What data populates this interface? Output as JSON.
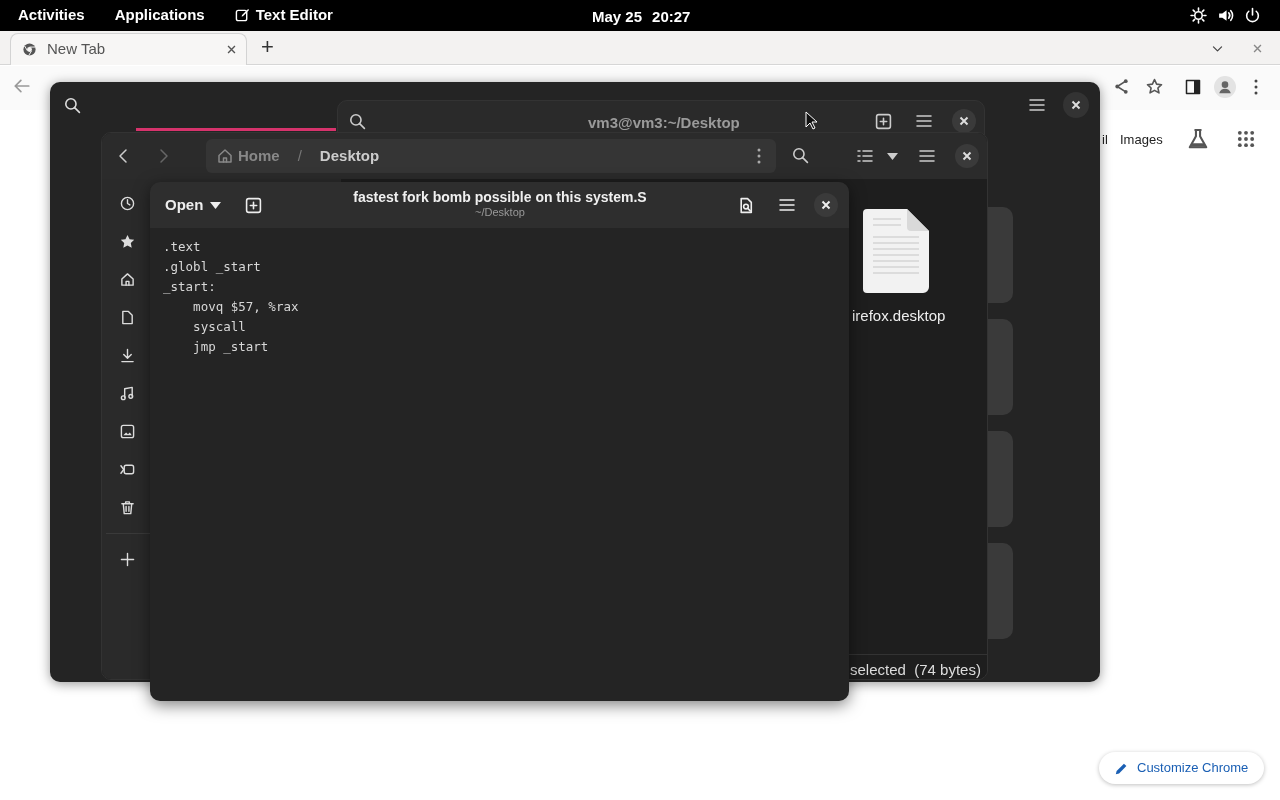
{
  "top_bar": {
    "activities": "Activities",
    "applications": "Applications",
    "app_name": "Text Editor",
    "date": "May 25",
    "time": "20:27"
  },
  "browser": {
    "tabs": [
      {
        "label": "New Tab",
        "selected": true
      }
    ],
    "new_tab": "+",
    "page_links": [
      "il",
      "Images"
    ],
    "customize_button": "Customize Chrome"
  },
  "terminal": {
    "title": "vm3@vm3:~/Desktop"
  },
  "files": {
    "path": [
      "Home",
      "Desktop"
    ],
    "separator": "/",
    "sidebar": [
      {
        "kind": "recent"
      },
      {
        "kind": "starred"
      },
      {
        "kind": "home"
      },
      {
        "kind": "documents"
      },
      {
        "kind": "downloads"
      },
      {
        "kind": "music"
      },
      {
        "kind": "pictures"
      },
      {
        "kind": "videos"
      },
      {
        "kind": "trash"
      },
      {
        "kind": "other"
      }
    ],
    "file_name": "irefox.desktop",
    "status": "selected  (74 bytes)"
  },
  "editor": {
    "open_button": "Open",
    "title": "fastest fork bomb possible on this system.S",
    "subtitle": "~/Desktop",
    "lines": [
      ".text",
      ".globl _start",
      "_start:",
      "    movq $57, %rax",
      "    syscall",
      "    jmp _start"
    ]
  }
}
